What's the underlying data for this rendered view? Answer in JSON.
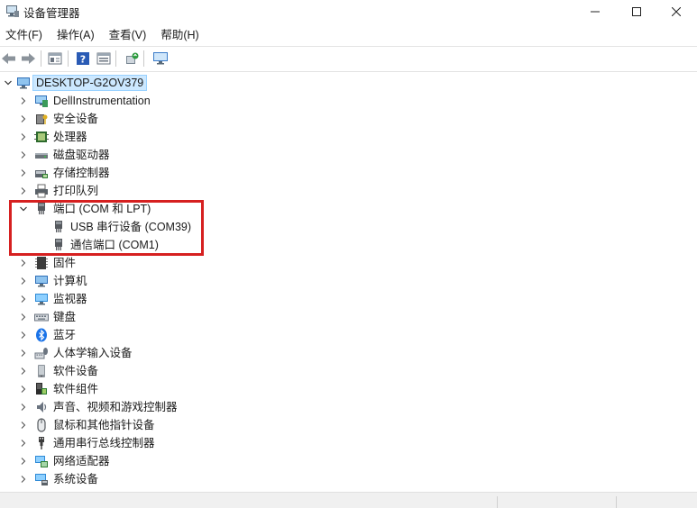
{
  "window": {
    "title": "设备管理器",
    "icon": "device-manager-icon"
  },
  "menu": [
    {
      "label": "文件(F)"
    },
    {
      "label": "操作(A)"
    },
    {
      "label": "查看(V)"
    },
    {
      "label": "帮助(H)"
    }
  ],
  "toolbar": {
    "icons": [
      "back-icon",
      "forward-icon",
      "properties-icon",
      "help-icon",
      "view-icon",
      "update-driver-icon",
      "monitor-icon"
    ]
  },
  "tree": {
    "root": {
      "label": "DESKTOP-G2OV379",
      "icon": "computer-icon"
    },
    "categories": [
      {
        "label": "DellInstrumentation",
        "icon": "dell-instrumentation-icon"
      },
      {
        "label": "安全设备",
        "icon": "security-device-icon"
      },
      {
        "label": "处理器",
        "icon": "processor-icon"
      },
      {
        "label": "磁盘驱动器",
        "icon": "disk-drive-icon"
      },
      {
        "label": "存储控制器",
        "icon": "storage-controller-icon"
      },
      {
        "label": "打印队列",
        "icon": "printer-icon"
      },
      {
        "label": "端口 (COM 和 LPT)",
        "icon": "port-icon",
        "expanded": true,
        "children": [
          {
            "label": "USB 串行设备 (COM39)",
            "icon": "port-icon"
          },
          {
            "label": "通信端口 (COM1)",
            "icon": "port-icon"
          }
        ]
      },
      {
        "label": "固件",
        "icon": "firmware-icon"
      },
      {
        "label": "计算机",
        "icon": "computer-icon"
      },
      {
        "label": "监视器",
        "icon": "monitor-icon"
      },
      {
        "label": "键盘",
        "icon": "keyboard-icon"
      },
      {
        "label": "蓝牙",
        "icon": "bluetooth-icon"
      },
      {
        "label": "人体学输入设备",
        "icon": "hid-icon"
      },
      {
        "label": "软件设备",
        "icon": "software-device-icon"
      },
      {
        "label": "软件组件",
        "icon": "software-component-icon"
      },
      {
        "label": "声音、视频和游戏控制器",
        "icon": "speaker-icon"
      },
      {
        "label": "鼠标和其他指针设备",
        "icon": "mouse-icon"
      },
      {
        "label": "通用串行总线控制器",
        "icon": "usb-icon"
      },
      {
        "label": "网络适配器",
        "icon": "network-adapter-icon"
      },
      {
        "label": "系统设备",
        "icon": "system-device-icon"
      }
    ]
  },
  "colors": {
    "highlight_border": "#d62020",
    "selection_bg": "#cce8ff",
    "selection_border": "#99d1ff"
  }
}
